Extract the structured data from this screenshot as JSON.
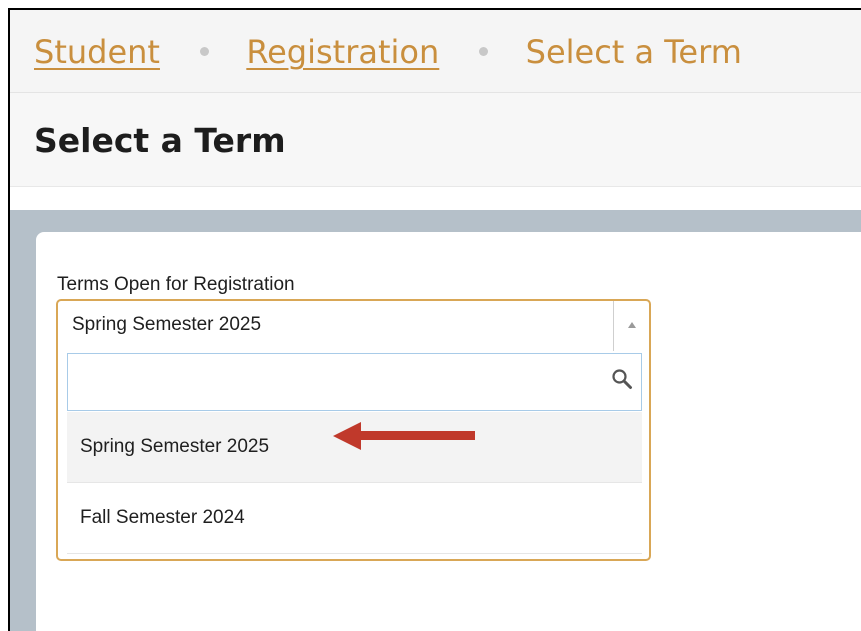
{
  "breadcrumb": {
    "items": [
      {
        "label": "Student"
      },
      {
        "label": "Registration"
      },
      {
        "label": "Select a Term"
      }
    ]
  },
  "page": {
    "title": "Select a Term"
  },
  "form": {
    "label": "Terms Open for Registration",
    "selected_value": "Spring Semester 2025",
    "search_placeholder": "",
    "search_value": "",
    "options": [
      {
        "label": "Spring Semester 2025",
        "highlighted": true
      },
      {
        "label": "Fall Semester 2024",
        "highlighted": false
      }
    ]
  },
  "colors": {
    "accent": "#c98f3e",
    "select_border": "#d9a756",
    "content_background": "#b5c0c9",
    "annotation_arrow": "#c0392b"
  },
  "icons": {
    "toggle": "caret-up-icon",
    "search": "search-icon",
    "annotation": "left-arrow-icon"
  }
}
